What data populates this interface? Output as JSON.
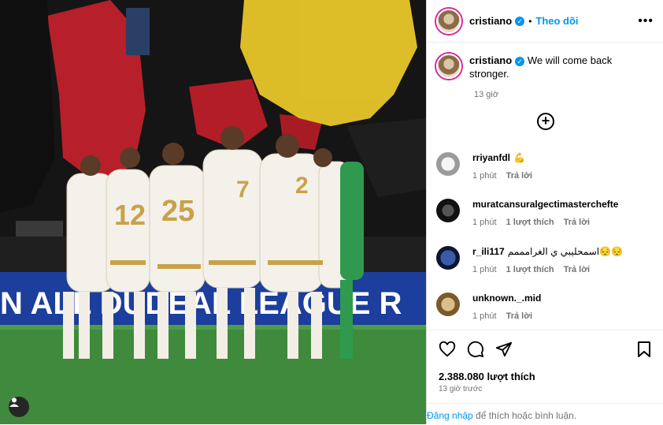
{
  "colors": {
    "accent": "#0095f6",
    "muted": "#737373",
    "border": "#dbdbdb"
  },
  "post": {
    "author": "cristiano",
    "follow_label": "Theo dõi",
    "more_icon": "more-horizontal-icon",
    "caption": "We will come back stronger.",
    "caption_time": "13 giờ",
    "likes": "2.388.080 lượt thích",
    "posted_ago": "13 giờ trước"
  },
  "media": {
    "banner_text": "N    ALL DUDEAL LEAGUE   R",
    "jersey_numbers": [
      "12",
      "25",
      "7",
      "2"
    ]
  },
  "comments": [
    {
      "user": "rriyanfdl",
      "text": "💪",
      "time": "1 phút",
      "likes": "",
      "reply": "Trả lời"
    },
    {
      "user": "muratcansuralgectimasterchefte",
      "text": "",
      "time": "1 phút",
      "likes": "1 lượt thích",
      "reply": "Trả lời"
    },
    {
      "user": "r_ili117",
      "text": "اسمحليبي ي الغرامممم😔😔",
      "time": "1 phút",
      "likes": "1 lượt thích",
      "reply": "Trả lời"
    },
    {
      "user": "unknown._.mid",
      "text": "",
      "time": "1 phút",
      "likes": "",
      "reply": "Trả lời"
    }
  ],
  "footer": {
    "login_link": "Đăng nhập",
    "login_rest": " để thích hoặc bình luận."
  }
}
